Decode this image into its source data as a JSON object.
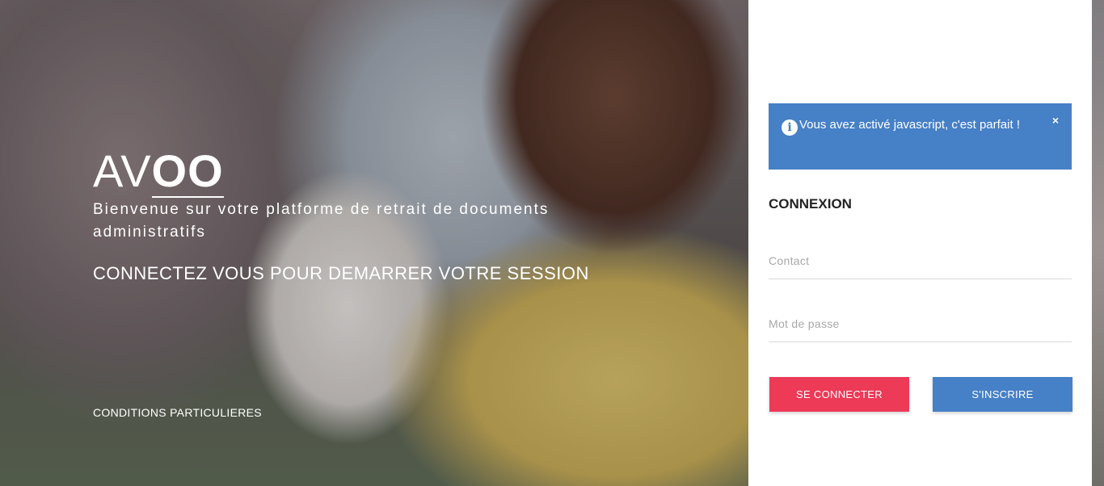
{
  "hero": {
    "logo_light": "AV",
    "logo_bold": "OO",
    "tagline": "Bienvenue sur votre platforme de retrait de documents administratifs",
    "cta": "CONNECTEZ VOUS POUR DEMARRER VOTRE SESSION",
    "conditions_link": "CONDITIONS PARTICULIERES"
  },
  "alert": {
    "icon": "info-icon",
    "message": "Vous avez activé javascript, c'est parfait !",
    "close_label": "×",
    "color": "#4680c6"
  },
  "form": {
    "title": "CONNEXION",
    "contact_placeholder": "Contact",
    "password_placeholder": "Mot de passe",
    "login_label": "SE CONNECTER",
    "signup_label": "S'INSCRIRE"
  },
  "colors": {
    "login_button": "#ec3a57",
    "signup_button": "#4680c6"
  }
}
